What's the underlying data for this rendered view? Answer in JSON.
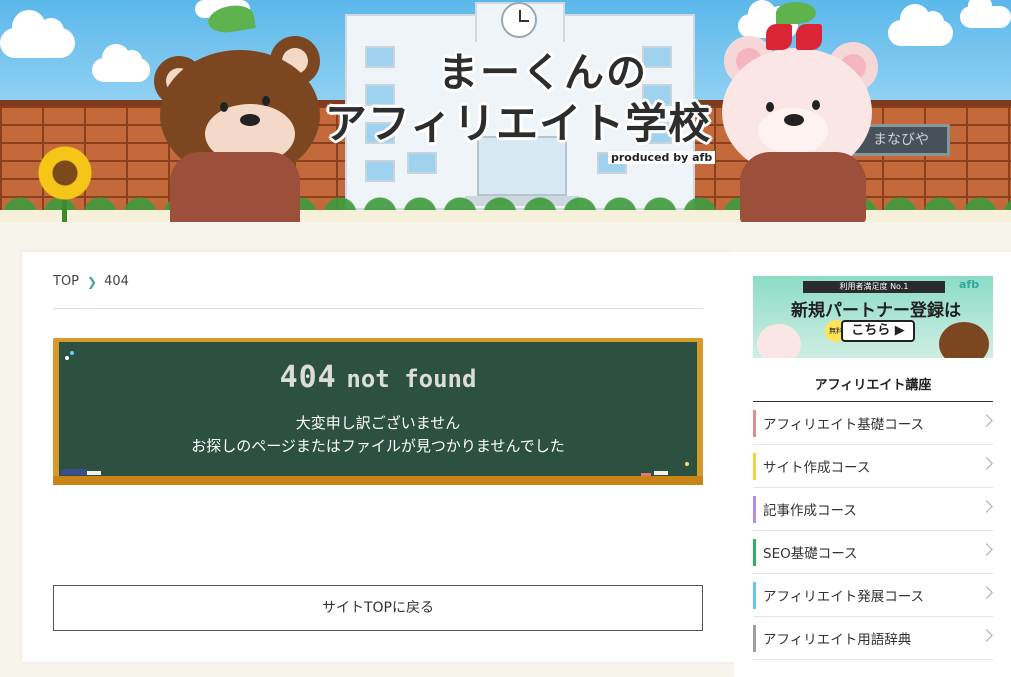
{
  "header": {
    "title_line1": "まーくんの",
    "title_line2": "アフィリエイト学校",
    "produced_by": "produced by afb",
    "sign_text": "まなびや"
  },
  "breadcrumb": {
    "home": "TOP",
    "current": "404"
  },
  "error_board": {
    "code": "404",
    "status": "not found",
    "line1": "大変申し訳ございません",
    "line2": "お探しのページまたはファイルが見つかりませんでした"
  },
  "back_button_label": "サイトTOPに戻る",
  "sidebar": {
    "banner": {
      "top_text": "利用者満足度 No.1",
      "brand": "afb",
      "main_text": "新規パートナー登録は",
      "free_badge": "無料",
      "cta": "こちら ▶"
    },
    "section_title": "アフィリエイト講座",
    "items": [
      {
        "label": "アフィリエイト基礎コース",
        "color": "#e58a95"
      },
      {
        "label": "サイト作成コース",
        "color": "#f0d33e"
      },
      {
        "label": "記事作成コース",
        "color": "#b68ee0"
      },
      {
        "label": "SEO基礎コース",
        "color": "#2fae6a"
      },
      {
        "label": "アフィリエイト発展コース",
        "color": "#66c6e8"
      },
      {
        "label": "アフィリエイト用語辞典",
        "color": "#9e9e9e"
      }
    ]
  }
}
